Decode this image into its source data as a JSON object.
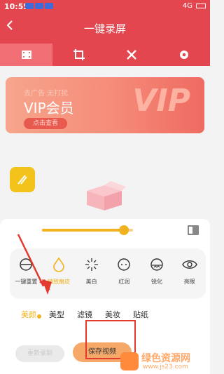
{
  "status": {
    "time": "10:55",
    "network": "4G",
    "battery": "▮"
  },
  "header": {
    "title": "一键录屏",
    "back_icon": "chevron-left-icon"
  },
  "tabs": [
    {
      "icon": "film-icon",
      "active": true
    },
    {
      "icon": "crop-icon",
      "active": false
    },
    {
      "icon": "tools-icon",
      "active": false
    },
    {
      "icon": "gear-icon",
      "active": false
    }
  ],
  "vip_banner": {
    "tagline": "去广告  无打扰",
    "title": "VIP会员",
    "button": "点击查看",
    "deco": "VIP"
  },
  "slider": {
    "value": 0.9
  },
  "tools": [
    {
      "label": "一键重置",
      "icon": "reset-icon"
    },
    {
      "label": "精致磨皮",
      "icon": "drop-icon",
      "selected": true
    },
    {
      "label": "美白",
      "icon": "sparkle-icon"
    },
    {
      "label": "红润",
      "icon": "face-icon"
    },
    {
      "label": "锐化",
      "icon": "sharpen-icon"
    },
    {
      "label": "亮眼",
      "icon": "eye-icon"
    }
  ],
  "categories": [
    {
      "label": "美颜",
      "selected": true
    },
    {
      "label": "美型"
    },
    {
      "label": "滤镜"
    },
    {
      "label": "美妆"
    },
    {
      "label": "贴纸"
    }
  ],
  "bottom": {
    "ghost_button": "重新录制",
    "save_button": "保存视频"
  },
  "watermark": {
    "title": "绿色资源网",
    "url": "www.js23.com"
  },
  "colors": {
    "accent": "#e3464f",
    "gold": "#f0b31f"
  }
}
